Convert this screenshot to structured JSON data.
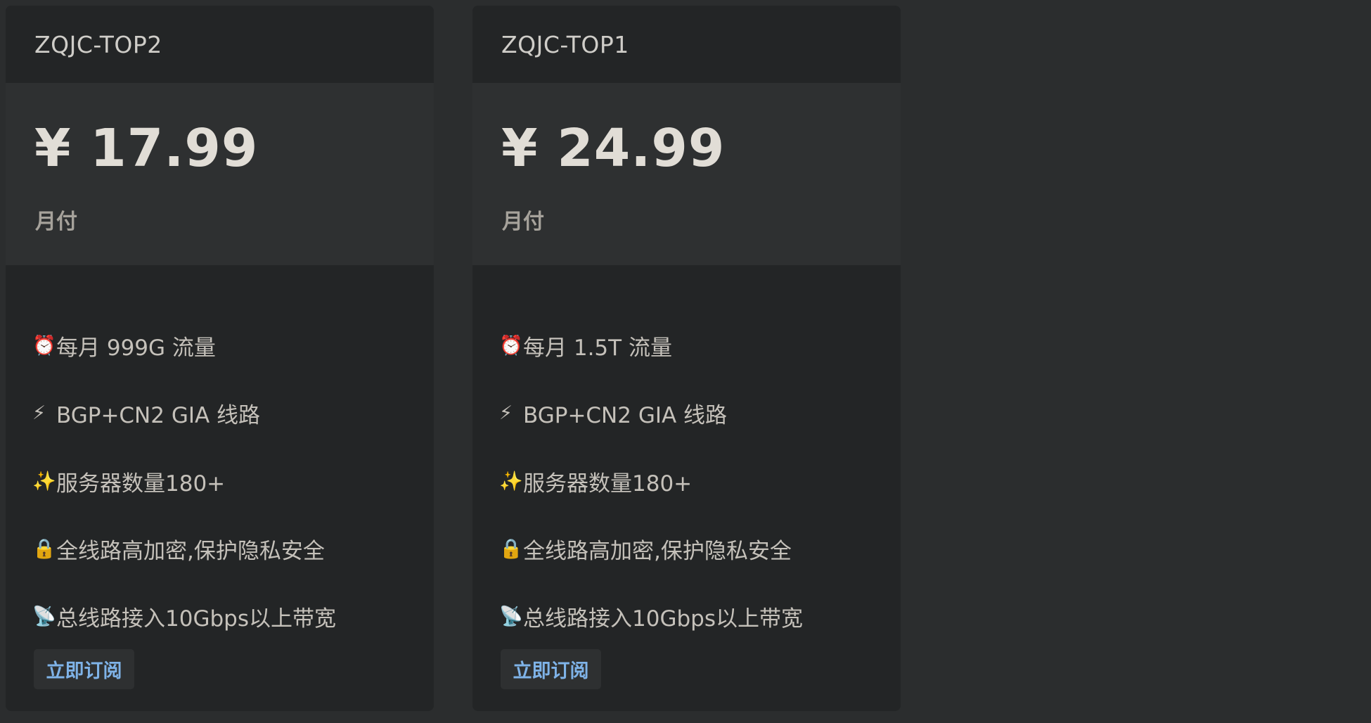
{
  "plans": [
    {
      "title": "ZQJC-TOP2",
      "price": "¥ 17.99",
      "period": "月付",
      "features": [
        {
          "icon": "alarm-clock-icon",
          "emoji": "⏰",
          "text": "每月 999G 流量"
        },
        {
          "icon": "lightning-icon",
          "emoji": "⚡",
          "text": "BGP+CN2 GIA 线路"
        },
        {
          "icon": "sparkles-icon",
          "emoji": "✨",
          "text": "服务器数量180+"
        },
        {
          "icon": "lock-icon",
          "emoji": "🔒",
          "text": "全线路高加密,保护隐私安全"
        },
        {
          "icon": "satellite-dish-icon",
          "emoji": "📡",
          "text": "总线路接入10Gbps以上带宽"
        }
      ],
      "button_label": "立即订阅"
    },
    {
      "title": "ZQJC-TOP1",
      "price": "¥ 24.99",
      "period": "月付",
      "features": [
        {
          "icon": "alarm-clock-icon",
          "emoji": "⏰",
          "text": "每月 1.5T 流量"
        },
        {
          "icon": "lightning-icon",
          "emoji": "⚡",
          "text": "BGP+CN2 GIA 线路"
        },
        {
          "icon": "sparkles-icon",
          "emoji": "✨",
          "text": "服务器数量180+"
        },
        {
          "icon": "lock-icon",
          "emoji": "🔒",
          "text": "全线路高加密,保护隐私安全"
        },
        {
          "icon": "satellite-dish-icon",
          "emoji": "📡",
          "text": "总线路接入10Gbps以上带宽"
        }
      ],
      "button_label": "立即订阅"
    }
  ],
  "colors": {
    "background": "#2b2d2e",
    "card": "#232526",
    "price_panel": "#2e3031",
    "accent": "#7fb3e8"
  }
}
